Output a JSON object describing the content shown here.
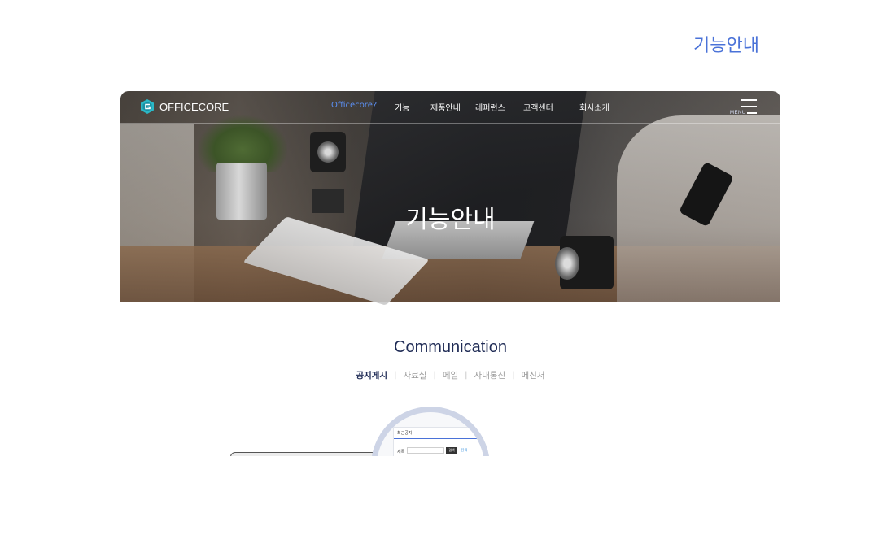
{
  "page": {
    "top_title": "기능안내"
  },
  "nav": {
    "logo_text": "OFFICECORE",
    "items": [
      {
        "label": "Officecore?",
        "active": true
      },
      {
        "label": "기능",
        "active": false
      },
      {
        "label": "제품안내",
        "active": false
      },
      {
        "label": "레퍼런스",
        "active": false
      },
      {
        "label": "고객센터",
        "active": false
      },
      {
        "label": "회사소개",
        "active": false
      }
    ],
    "menu_label": "MENU",
    "accent_color": "#5b8ef0"
  },
  "hero": {
    "title": "기능안내"
  },
  "section": {
    "title": "Communication",
    "tabs": [
      {
        "label": "공지게시",
        "active": true
      },
      {
        "label": "자료실",
        "active": false
      },
      {
        "label": "메일",
        "active": false
      },
      {
        "label": "사내통신",
        "active": false
      },
      {
        "label": "메신저",
        "active": false
      }
    ]
  },
  "preview": {
    "panel_title": "최근공지",
    "row_label": "제목",
    "button_label": "검색",
    "link_label": "검색"
  },
  "colors": {
    "top_title": "#4a72d8",
    "section_title": "#1f2b55",
    "tab_inactive": "#9a9a9a"
  }
}
